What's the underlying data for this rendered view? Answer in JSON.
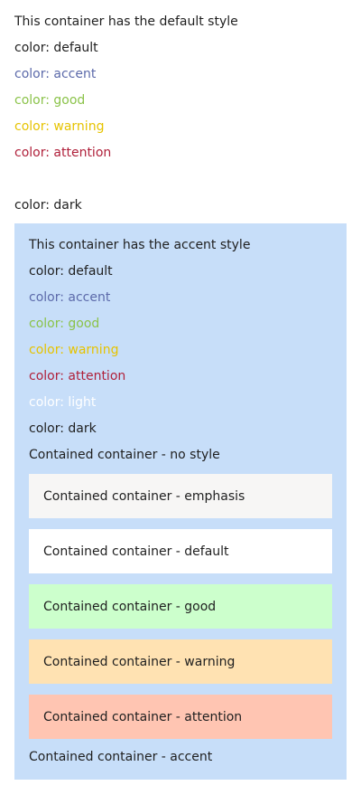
{
  "default_container": {
    "heading": "This container has the default style",
    "lines": {
      "default": "color: default",
      "accent": "color: accent",
      "good": "color: good",
      "warning": "color: warning",
      "attention": "color: attention",
      "dark": "color: dark"
    }
  },
  "accent_container": {
    "heading": "This container has the accent style",
    "lines": {
      "default": "color: default",
      "accent": "color: accent",
      "good": "color: good",
      "warning": "color: warning",
      "attention": "color: attention",
      "light": "color: light",
      "dark": "color: dark"
    },
    "no_style_label": "Contained container - no style",
    "contained": {
      "emphasis": "Contained container - emphasis",
      "default": "Contained container - default",
      "good": "Contained container - good",
      "warning": "Contained container - warning",
      "attention": "Contained container - attention"
    },
    "accent_label": "Contained container - accent"
  },
  "colors": {
    "accent_container_bg": "#c7def9",
    "text_default": "#1f1f1f",
    "text_accent": "#5c6aaa",
    "text_good": "#8bc34a",
    "text_warning": "#e6c300",
    "text_attention": "#b0213b",
    "text_light": "#ffffff",
    "contained_emphasis": "#f7f6f5",
    "contained_default": "#ffffff",
    "contained_good": "#ccffcc",
    "contained_warning": "#ffe2b2",
    "contained_attention": "#ffc5b2"
  }
}
